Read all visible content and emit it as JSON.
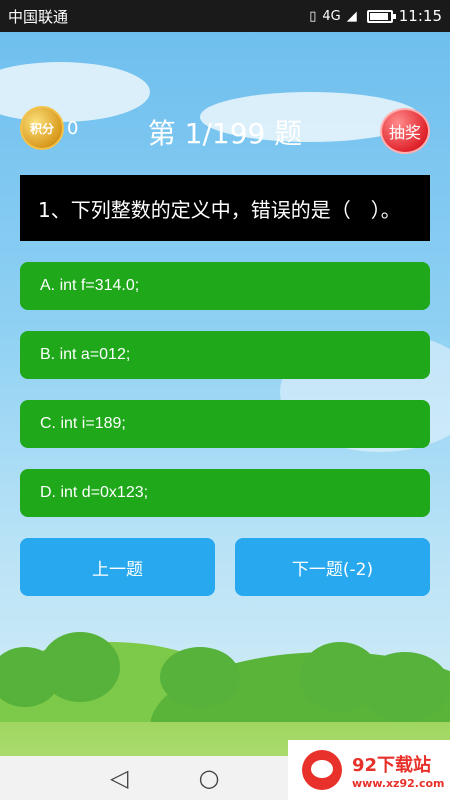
{
  "status_bar": {
    "carrier": "中国联通",
    "network": "4G",
    "time": "11:15"
  },
  "header": {
    "coin_label": "积分",
    "score": "0",
    "title": "第 1/199 题",
    "lottery_label": "抽奖"
  },
  "question": {
    "text": "1、下列整数的定义中，错误的是（　）。"
  },
  "options": [
    {
      "text": "A. int f=314.0;"
    },
    {
      "text": "B. int a=012;"
    },
    {
      "text": "C. int i=189;"
    },
    {
      "text": "D. int d=0x123;"
    }
  ],
  "buttons": {
    "prev_label": "上一题",
    "next_label": "下一题(-2)"
  },
  "watermark": {
    "title": "92下载站",
    "url": "www.xz92.com"
  },
  "colors": {
    "option_green": "#1ea81a",
    "button_blue": "#28a8ef",
    "lottery_red": "#e0242c",
    "coin_gold": "#d99a1e"
  },
  "icons": [
    "vibrate-icon",
    "signal-icon",
    "battery-icon",
    "back-icon",
    "home-icon",
    "recents-icon"
  ]
}
